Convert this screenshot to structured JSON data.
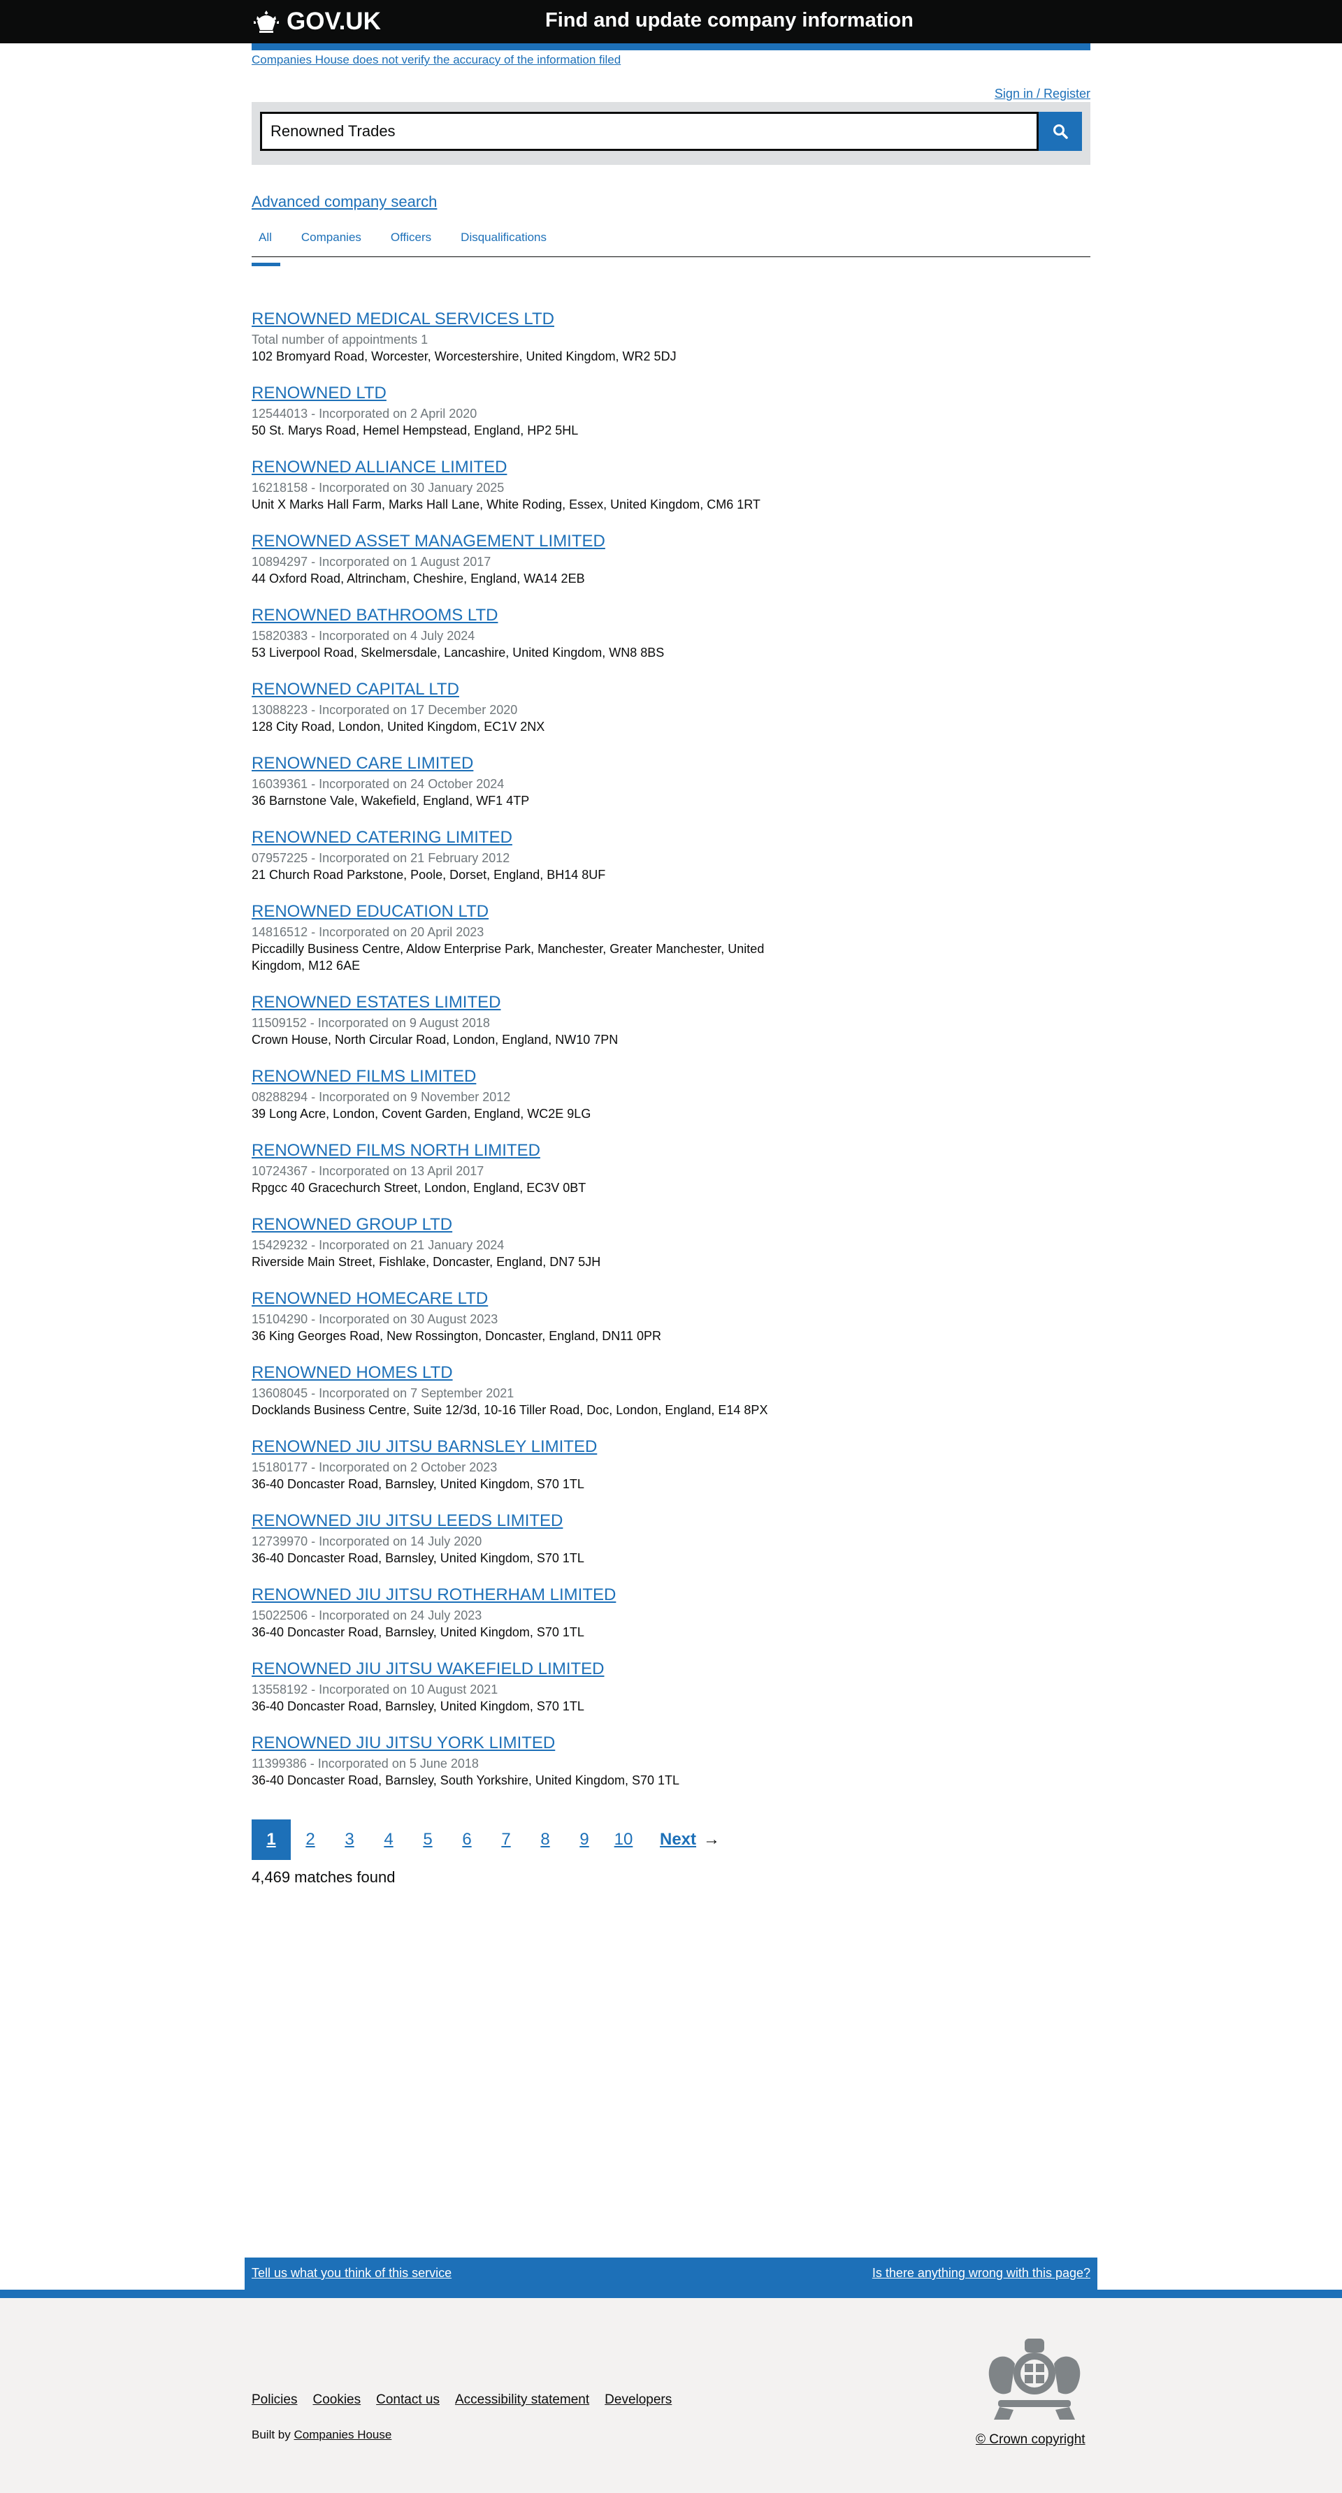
{
  "header": {
    "logo_text": "GOV.UK",
    "service_name": "Find and update company information",
    "disclaimer": "Companies House does not verify the accuracy of the information filed",
    "sign_in": "Sign in / Register"
  },
  "search": {
    "value": "Renowned Trades",
    "button_icon": "search-icon"
  },
  "advanced_search": "Advanced company search",
  "tabs": [
    {
      "label": "All",
      "active": true
    },
    {
      "label": "Companies",
      "active": false
    },
    {
      "label": "Officers",
      "active": false
    },
    {
      "label": "Disqualifications",
      "active": false
    }
  ],
  "results": [
    {
      "title": "RENOWNED MEDICAL SERVICES LTD",
      "meta": "Total number of appointments 1",
      "address": "102 Bromyard Road, Worcester, Worcestershire, United Kingdom, WR2 5DJ"
    },
    {
      "title": "RENOWNED LTD",
      "meta": "12544013 - Incorporated on 2 April 2020",
      "address": "50 St. Marys Road, Hemel Hempstead, England, HP2 5HL"
    },
    {
      "title": "RENOWNED ALLIANCE LIMITED",
      "meta": "16218158 - Incorporated on 30 January 2025",
      "address": "Unit X Marks Hall Farm, Marks Hall Lane, White Roding, Essex, United Kingdom, CM6 1RT"
    },
    {
      "title": "RENOWNED ASSET MANAGEMENT LIMITED",
      "meta": "10894297 - Incorporated on 1 August 2017",
      "address": "44 Oxford Road, Altrincham, Cheshire, England, WA14 2EB"
    },
    {
      "title": "RENOWNED BATHROOMS LTD",
      "meta": "15820383 - Incorporated on 4 July 2024",
      "address": "53 Liverpool Road, Skelmersdale, Lancashire, United Kingdom, WN8 8BS"
    },
    {
      "title": "RENOWNED CAPITAL LTD",
      "meta": "13088223 - Incorporated on 17 December 2020",
      "address": "128 City Road, London, United Kingdom, EC1V 2NX"
    },
    {
      "title": "RENOWNED CARE LIMITED",
      "meta": "16039361 - Incorporated on 24 October 2024",
      "address": "36 Barnstone Vale, Wakefield, England, WF1 4TP"
    },
    {
      "title": "RENOWNED CATERING LIMITED",
      "meta": "07957225 - Incorporated on 21 February 2012",
      "address": "21 Church Road Parkstone, Poole, Dorset, England, BH14 8UF"
    },
    {
      "title": "RENOWNED EDUCATION LTD",
      "meta": "14816512 - Incorporated on 20 April 2023",
      "address": "Piccadilly Business Centre, Aldow Enterprise Park, Manchester, Greater Manchester, United Kingdom, M12 6AE"
    },
    {
      "title": "RENOWNED ESTATES LIMITED",
      "meta": "11509152 - Incorporated on 9 August 2018",
      "address": "Crown House, North Circular Road, London, England, NW10 7PN"
    },
    {
      "title": "RENOWNED FILMS LIMITED",
      "meta": "08288294 - Incorporated on 9 November 2012",
      "address": "39 Long Acre, London, Covent Garden, England, WC2E 9LG"
    },
    {
      "title": "RENOWNED FILMS NORTH LIMITED",
      "meta": "10724367 - Incorporated on 13 April 2017",
      "address": "Rpgcc 40 Gracechurch Street, London, England, EC3V 0BT"
    },
    {
      "title": "RENOWNED GROUP LTD",
      "meta": "15429232 - Incorporated on 21 January 2024",
      "address": "Riverside Main Street, Fishlake, Doncaster, England, DN7 5JH"
    },
    {
      "title": "RENOWNED HOMECARE LTD",
      "meta": "15104290 - Incorporated on 30 August 2023",
      "address": "36 King Georges Road, New Rossington, Doncaster, England, DN11 0PR"
    },
    {
      "title": "RENOWNED HOMES LTD",
      "meta": "13608045 - Incorporated on 7 September 2021",
      "address": "Docklands Business Centre, Suite 12/3d, 10-16 Tiller Road, Doc, London, England, E14 8PX"
    },
    {
      "title": "RENOWNED JIU JITSU BARNSLEY LIMITED",
      "meta": "15180177 - Incorporated on 2 October 2023",
      "address": "36-40 Doncaster Road, Barnsley, United Kingdom, S70 1TL"
    },
    {
      "title": "RENOWNED JIU JITSU LEEDS LIMITED",
      "meta": "12739970 - Incorporated on 14 July 2020",
      "address": "36-40 Doncaster Road, Barnsley, United Kingdom, S70 1TL"
    },
    {
      "title": "RENOWNED JIU JITSU ROTHERHAM LIMITED",
      "meta": "15022506 - Incorporated on 24 July 2023",
      "address": "36-40 Doncaster Road, Barnsley, United Kingdom, S70 1TL"
    },
    {
      "title": "RENOWNED JIU JITSU WAKEFIELD LIMITED",
      "meta": "13558192 - Incorporated on 10 August 2021",
      "address": "36-40 Doncaster Road, Barnsley, United Kingdom, S70 1TL"
    },
    {
      "title": "RENOWNED JIU JITSU YORK LIMITED",
      "meta": "11399386 - Incorporated on 5 June 2018",
      "address": "36-40 Doncaster Road, Barnsley, South Yorkshire, United Kingdom, S70 1TL"
    }
  ],
  "pagination": {
    "pages": [
      "1",
      "2",
      "3",
      "4",
      "5",
      "6",
      "7",
      "8",
      "9",
      "10"
    ],
    "current": "1",
    "next_label": "Next",
    "matches": "4,469 matches found"
  },
  "feedback": {
    "left": "Tell us what you think of this service",
    "right": "Is there anything wrong with this page?"
  },
  "footer": {
    "links": [
      "Policies",
      "Cookies",
      "Contact us",
      "Accessibility statement",
      "Developers"
    ],
    "built_by_prefix": "Built by",
    "built_by_link": "Companies House",
    "copyright": "© Crown copyright"
  },
  "colors": {
    "link": "#1d70b8",
    "header_bg": "#0b0c0c",
    "footer_bg": "#f3f2f1",
    "meta_text": "#6f777b"
  }
}
